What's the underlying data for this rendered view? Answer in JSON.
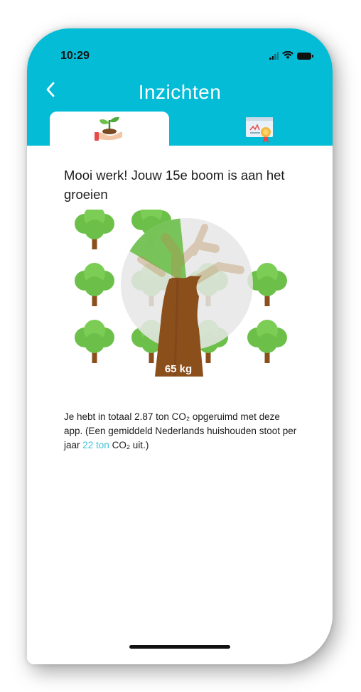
{
  "status_bar": {
    "time": "10:29"
  },
  "header": {
    "title": "Inzichten"
  },
  "tabs": [
    {
      "name": "plant",
      "icon": "plant-in-hand-icon",
      "active": true
    },
    {
      "name": "certificate",
      "icon": "certificate-icon",
      "active": false
    }
  ],
  "headline": "Mooi werk! Jouw 15e boom is aan het groeien",
  "tree": {
    "label": "65 kg",
    "progress_fraction": 0.15
  },
  "stats": {
    "text_before": "Je hebt in totaal 2.87 ton CO₂ opgeruimd met deze app. (Een gemiddeld Nederlands huishouden stoot per jaar ",
    "link_text": "22 ton",
    "text_after": " CO₂ uit.)"
  },
  "colors": {
    "accent": "#04bcd6",
    "link": "#3cc2d8",
    "tree_green": "#6cc04a",
    "trunk": "#8b4f1c"
  }
}
